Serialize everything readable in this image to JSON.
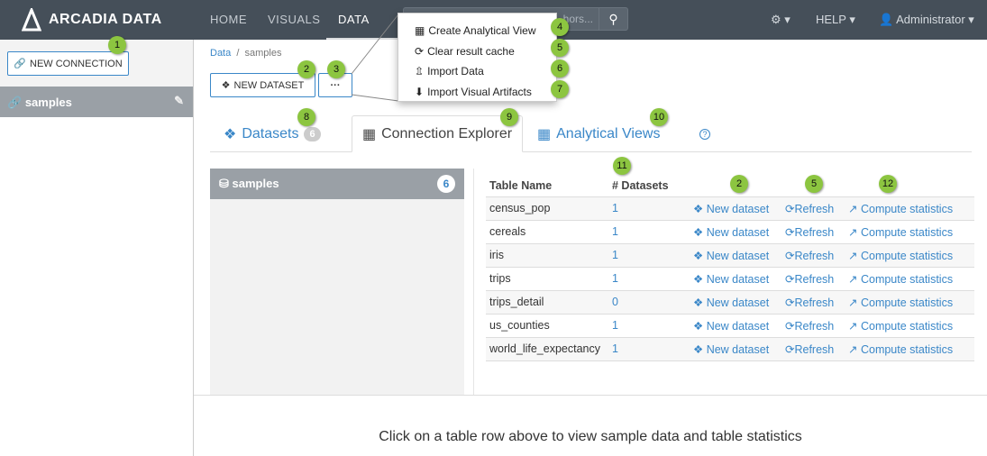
{
  "nav": {
    "logo": "ARCADIA DATA",
    "links": [
      "HOME",
      "VISUALS",
      "DATA"
    ],
    "active": "DATA",
    "search_placeholder": "hors...",
    "help": "HELP",
    "user": "Administrator"
  },
  "sidebar": {
    "new_connection": "NEW CONNECTION",
    "connection": "samples"
  },
  "breadcrumb": {
    "root": "Data",
    "current": "samples"
  },
  "toolbar": {
    "new_dataset": "NEW DATASET",
    "more": "···"
  },
  "menu": {
    "items": [
      "Create Analytical View",
      "Clear result cache",
      "Import Data",
      "Import Visual Artifacts"
    ]
  },
  "tabs": {
    "datasets": "Datasets",
    "datasets_count": "6",
    "explorer": "Connection Explorer",
    "views": "Analytical Views",
    "help": "?"
  },
  "explorer": {
    "db": "samples",
    "db_count": "6"
  },
  "table": {
    "headers": [
      "Table Name",
      "# Datasets"
    ],
    "actions": [
      "New dataset",
      "Refresh",
      "Compute statistics"
    ],
    "rows": [
      [
        "census_pop",
        "1"
      ],
      [
        "cereals",
        "1"
      ],
      [
        "iris",
        "1"
      ],
      [
        "trips",
        "1"
      ],
      [
        "trips_detail",
        "0"
      ],
      [
        "us_counties",
        "1"
      ],
      [
        "world_life_expectancy",
        "1"
      ]
    ]
  },
  "footer_msg": "Click on a table row above to view sample data and table statistics",
  "callouts": [
    "1",
    "2",
    "3",
    "4",
    "5",
    "6",
    "7",
    "8",
    "9",
    "10",
    "11",
    "2",
    "5",
    "12"
  ],
  "colors": {
    "navbar": "#454f59",
    "accent": "#3a87c8",
    "callout": "#8cc540"
  }
}
